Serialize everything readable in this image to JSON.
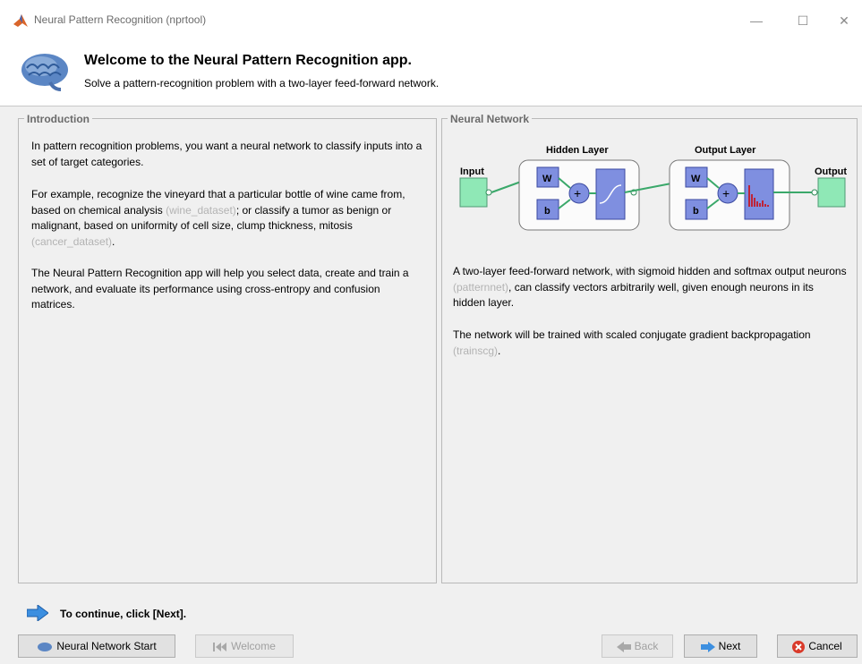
{
  "window": {
    "title": "Neural Pattern Recognition (nprtool)",
    "controls": [
      "—",
      "☐",
      "✕"
    ]
  },
  "header": {
    "title": "Welcome to the Neural Pattern Recognition app.",
    "subtitle": "Solve a pattern-recognition problem with a two-layer feed-forward network."
  },
  "intro": {
    "legend": "Introduction",
    "p1": "In pattern recognition problems, you want a neural network to classify inputs into a set of target categories.",
    "p2_a": "For example, recognize the vineyard that a particular bottle of wine came from, based on chemical analysis ",
    "p2_link1": "(wine_dataset)",
    "p2_b": "; or classify a tumor as benign or malignant, based on uniformity of cell size, clump thickness, mitosis ",
    "p2_link2": "(cancer_dataset)",
    "p2_c": ".",
    "p3": "The Neural Pattern Recognition app will help you select data, create and train a network, and evaluate its performance using cross-entropy and confusion matrices."
  },
  "network": {
    "legend": "Neural Network",
    "diagram": {
      "input_label": "Input",
      "hidden_label": "Hidden Layer",
      "output_layer_label": "Output Layer",
      "output_label": "Output",
      "w": "W",
      "b": "b",
      "plus": "+"
    },
    "p1_a": "A two-layer feed-forward network, with sigmoid hidden and softmax output neurons ",
    "p1_link": "(patternnet)",
    "p1_b": ", can classify vectors arbitrarily well, given enough neurons in its hidden layer.",
    "p2_a": "The network will be trained with scaled conjugate gradient backpropagation ",
    "p2_link": "(trainscg)",
    "p2_b": "."
  },
  "footer": {
    "continue": "To continue, click [Next].",
    "buttons": {
      "nn_start": "Neural Network Start",
      "welcome": "Welcome",
      "back": "Back",
      "next": "Next",
      "cancel": "Cancel"
    }
  },
  "colors": {
    "io_green": "#8fe8b6",
    "layer_blue": "#7f8fe0",
    "link_gray": "#b3b3b3",
    "accent_blue": "#3c8fe0"
  }
}
